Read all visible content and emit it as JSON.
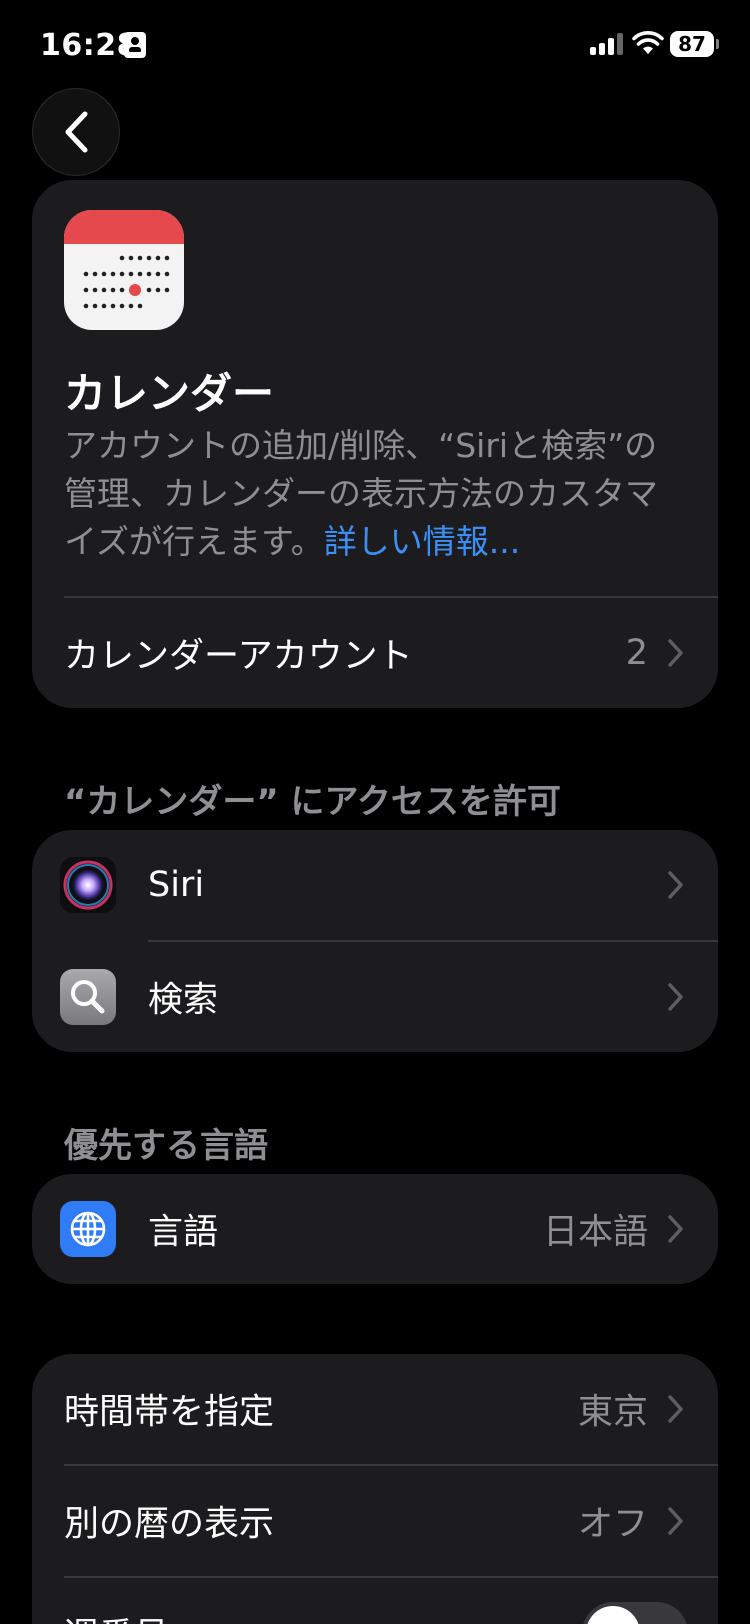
{
  "status_bar": {
    "time": "16:28",
    "battery": "87"
  },
  "header": {
    "app_name": "カレンダー",
    "description": "アカウントの追加/削除、“Siriと検索”の管理、カレンダーの表示方法のカスタマイズが行えます。",
    "more_link": "詳しい情報...",
    "accounts_label": "カレンダーアカウント",
    "accounts_count": "2"
  },
  "access_section": {
    "header": "“カレンダー” にアクセスを許可",
    "items": [
      {
        "label": "Siri",
        "icon": "siri-icon"
      },
      {
        "label": "検索",
        "icon": "search-icon"
      }
    ]
  },
  "language_section": {
    "header": "優先する言語",
    "label": "言語",
    "value": "日本語",
    "icon": "globe-icon",
    "icon_color": "#2f7cf6"
  },
  "settings_section": {
    "timezone_label": "時間帯を指定",
    "timezone_value": "東京",
    "alt_calendar_label": "別の暦の表示",
    "alt_calendar_value": "オフ",
    "week_numbers_label": "週番号"
  },
  "colors": {
    "accent": "#3b8ff6",
    "calendar_red": "#e5484d"
  }
}
